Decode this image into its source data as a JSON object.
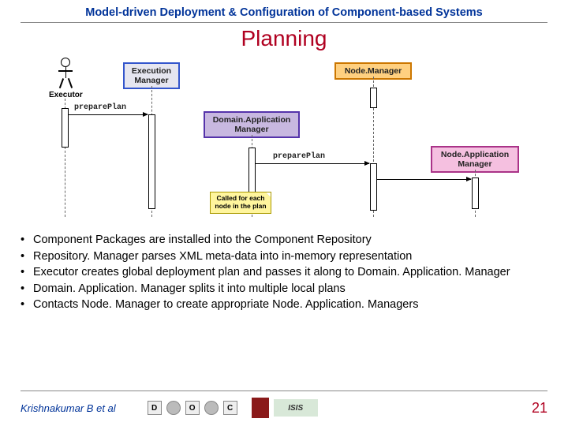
{
  "header": "Model-driven Deployment & Configuration of Component-based Systems",
  "title": "Planning",
  "diagram": {
    "actor": "Executor",
    "objects": {
      "exec_mgr": "Execution\nManager",
      "domain_mgr": "Domain.Application\nManager",
      "node_mgr": "Node.Manager",
      "node_app_mgr": "Node.Application\nManager"
    },
    "messages": {
      "m1": "preparePlan",
      "m2": "preparePlan"
    },
    "note": "Called for each node in the plan"
  },
  "bullets": [
    "Component Packages are installed into the Component Repository",
    "Repository. Manager parses XML meta-data into in-memory representation",
    "Executor creates global deployment plan and passes it along to Domain. Application. Manager",
    "Domain. Application. Manager splits it into multiple local plans",
    "Contacts Node. Manager to create appropriate Node. Application. Managers"
  ],
  "footer": {
    "author": "Krishnakumar B et al",
    "logo_letters": [
      "D",
      "O",
      "C"
    ],
    "isis": "ISIS"
  },
  "slide_number": "21"
}
